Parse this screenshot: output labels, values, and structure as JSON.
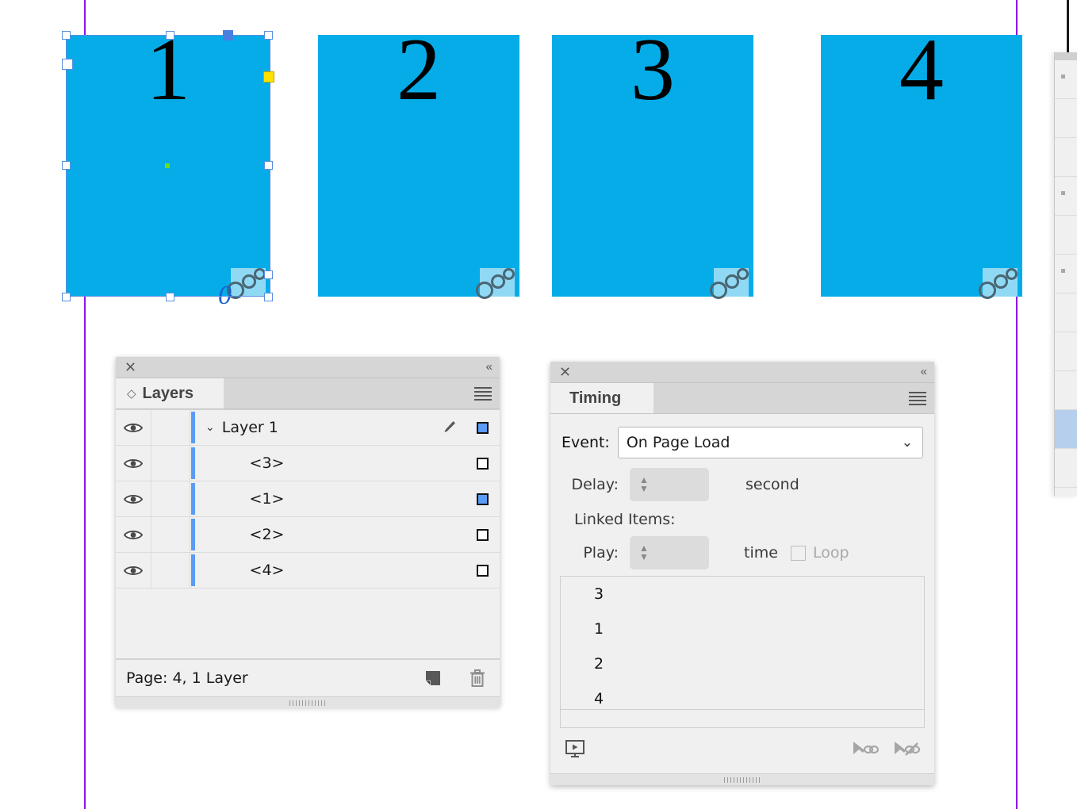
{
  "app": {
    "accent_blue": "#5a9cf5",
    "artboard_fill": "#05ACE8",
    "guide_color": "#9013e8"
  },
  "canvas": {
    "name": "artboard-canvas",
    "artboards": [
      {
        "label": "1",
        "selected": true,
        "badge": "animation-badge",
        "zero_mark": "0"
      },
      {
        "label": "2",
        "selected": false,
        "badge": "animation-badge"
      },
      {
        "label": "3",
        "selected": false,
        "badge": "animation-badge"
      },
      {
        "label": "4",
        "selected": false,
        "badge": "animation-badge"
      }
    ]
  },
  "layers_panel": {
    "close_label": "×",
    "collapse_label": "«",
    "tab_label": "Layers",
    "menu_label": "panel-menu",
    "rows": [
      {
        "name": "Layer 1",
        "is_parent": true,
        "disclosure": "⌄",
        "targeted": true,
        "has_pencil": true
      },
      {
        "name": "<3>",
        "is_parent": false,
        "targeted": false,
        "has_pencil": false
      },
      {
        "name": "<1>",
        "is_parent": false,
        "targeted": true,
        "has_pencil": false
      },
      {
        "name": "<2>",
        "is_parent": false,
        "targeted": false,
        "has_pencil": false
      },
      {
        "name": "<4>",
        "is_parent": false,
        "targeted": false,
        "has_pencil": false
      }
    ],
    "status_text": "Page: 4, 1 Layer",
    "new_layer_label": "new-layer",
    "delete_layer_label": "delete-layer"
  },
  "timing_panel": {
    "close_label": "×",
    "collapse_label": "«",
    "tab_label": "Timing",
    "menu_label": "panel-menu",
    "event_label": "Event:",
    "event_value": "On Page Load",
    "event_chevron": "⌄",
    "delay_label": "Delay:",
    "delay_value": "",
    "delay_unit": "second",
    "linked_items_label": "Linked Items:",
    "play_label": "Play:",
    "play_value": "",
    "play_unit": "time",
    "loop_label": "Loop",
    "loop_checked": false,
    "linked_items": [
      "3",
      "1",
      "2",
      "4"
    ],
    "preview_label": "preview-spread",
    "link_label": "link-items",
    "unlink_label": "unlink-items"
  }
}
